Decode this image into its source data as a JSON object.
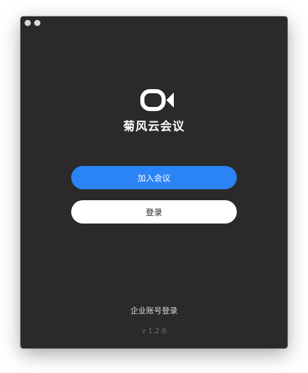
{
  "app": {
    "name": "菊风云会议",
    "logo_icon": "video-camera-icon",
    "accent_color": "#2b84f5"
  },
  "window": {
    "controls": [
      "close-dot",
      "minimize-dot"
    ]
  },
  "actions": {
    "join_meeting_label": "加入会议",
    "login_label": "登录"
  },
  "footer": {
    "enterprise_login_label": "企业账号登录",
    "version": "v 1.2.6"
  }
}
